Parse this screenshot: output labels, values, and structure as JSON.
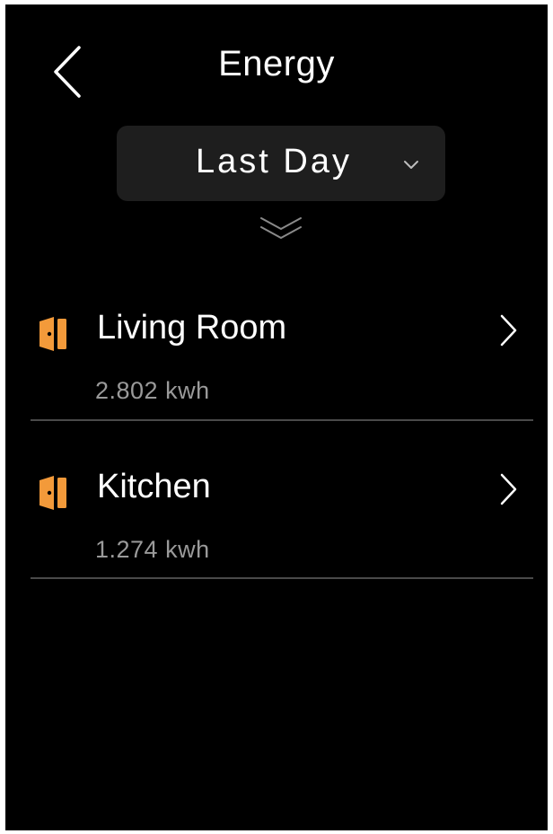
{
  "header": {
    "title": "Energy"
  },
  "range_select": {
    "selected": "Last Day"
  },
  "rooms": [
    {
      "name": "Living Room",
      "value": "2.802 kwh"
    },
    {
      "name": "Kitchen",
      "value": "1.274 kwh"
    }
  ],
  "colors": {
    "background": "#000000",
    "accent_orange": "#f39a3a",
    "select_bg": "#1e1e1e",
    "secondary_text": "#9a9a9a",
    "divider": "#4a4a4a"
  },
  "icons": {
    "back": "chevron-left-icon",
    "dropdown": "chevron-down-icon",
    "expand": "double-chevron-down-icon",
    "room": "door-icon",
    "row": "chevron-right-icon"
  }
}
